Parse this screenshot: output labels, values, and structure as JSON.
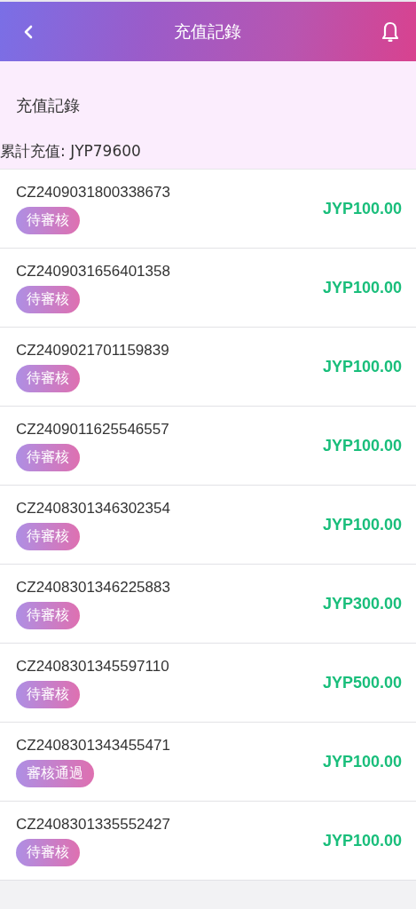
{
  "header": {
    "title": "充值記錄"
  },
  "section": {
    "title": "充值記錄",
    "total": "累計充值: JYP79600"
  },
  "records": [
    {
      "id": "CZ2409031800338673",
      "status": "待審核",
      "amount": "JYP100.00"
    },
    {
      "id": "CZ2409031656401358",
      "status": "待審核",
      "amount": "JYP100.00"
    },
    {
      "id": "CZ2409021701159839",
      "status": "待審核",
      "amount": "JYP100.00"
    },
    {
      "id": "CZ2409011625546557",
      "status": "待審核",
      "amount": "JYP100.00"
    },
    {
      "id": "CZ2408301346302354",
      "status": "待審核",
      "amount": "JYP100.00"
    },
    {
      "id": "CZ2408301346225883",
      "status": "待審核",
      "amount": "JYP300.00"
    },
    {
      "id": "CZ2408301345597110",
      "status": "待審核",
      "amount": "JYP500.00"
    },
    {
      "id": "CZ2408301343455471",
      "status": "審核通過",
      "amount": "JYP100.00"
    },
    {
      "id": "CZ2408301335552427",
      "status": "待審核",
      "amount": "JYP100.00"
    }
  ]
}
